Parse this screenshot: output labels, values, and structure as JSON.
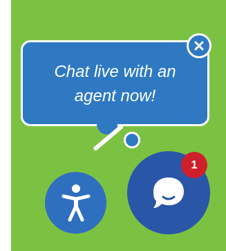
{
  "chat_prompt": {
    "message": "Chat live with an agent now!"
  },
  "chat_launcher": {
    "unread_count": "1"
  },
  "icons": {
    "close": "close-icon",
    "accessibility": "accessibility-icon",
    "chat": "chat-bubble-icon"
  },
  "colors": {
    "background": "#7cc242",
    "bubble": "#2f79c2",
    "chat_button": "#2a56a8",
    "accessibility_button": "#2e6fbf",
    "badge": "#cf1f2b"
  }
}
